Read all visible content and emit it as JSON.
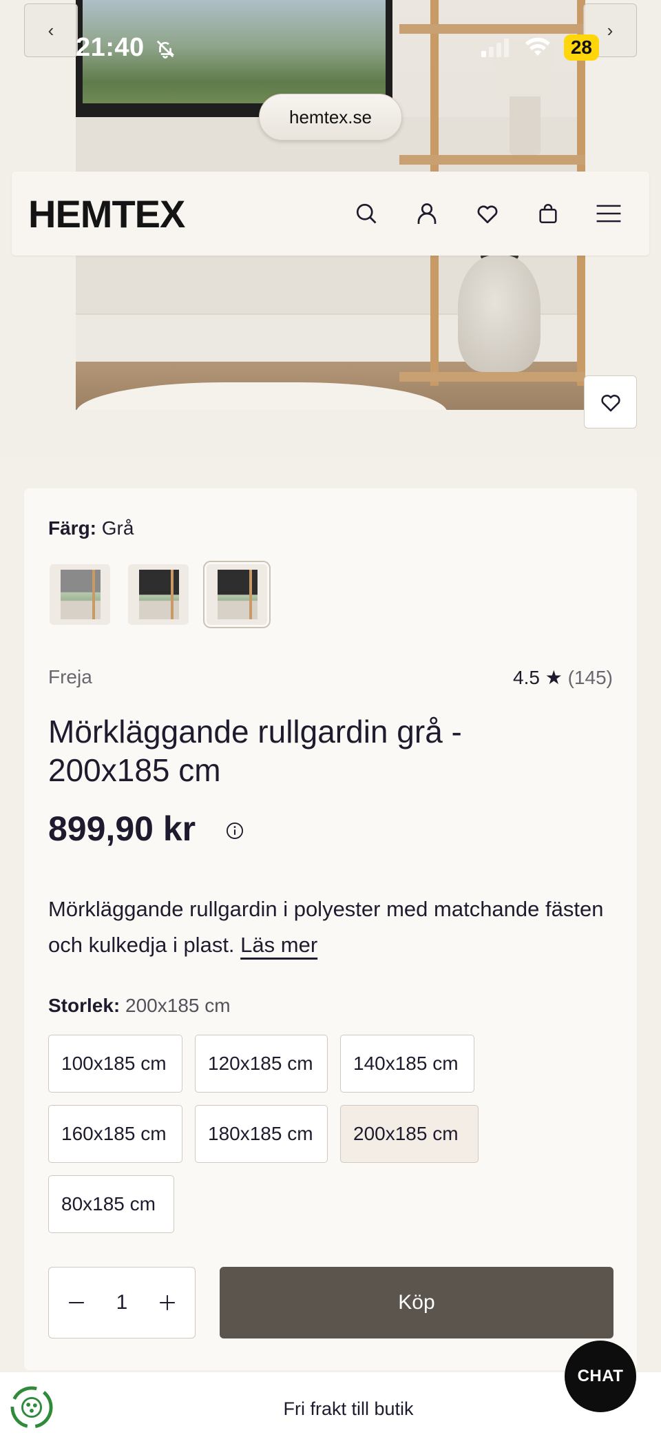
{
  "status_bar": {
    "time": "21:40",
    "battery": "28"
  },
  "browser": {
    "url": "hemtex.se"
  },
  "header": {
    "logo": "HEMTEX"
  },
  "product": {
    "color_label": "Färg:",
    "color_value": "Grå",
    "brand": "Freja",
    "rating": "4.5 ★",
    "review_count": "(145)",
    "title": "Mörkläggande rullgardin grå - 200x185 cm",
    "price": "899,90 kr",
    "description": "Mörkläggande rullgardin i polyester med matchande fästen och kulkedja i plast.",
    "read_more": "Läs mer",
    "size_label": "Storlek:",
    "size_value": "200x185 cm",
    "sizes": [
      "100x185 cm",
      "120x185 cm",
      "140x185 cm",
      "160x185 cm",
      "180x185 cm",
      "200x185 cm",
      "80x185 cm"
    ],
    "selected_size": "200x185 cm",
    "quantity": "1",
    "buy_label": "Köp"
  },
  "footer": {
    "shipping_text": "Fri frakt till butik",
    "chat_label": "CHAT"
  },
  "icons": [
    "chevron-left-icon",
    "chevron-right-icon",
    "search-icon",
    "user-icon",
    "heart-icon",
    "bag-icon",
    "menu-icon",
    "info-icon",
    "recycle-icon"
  ]
}
